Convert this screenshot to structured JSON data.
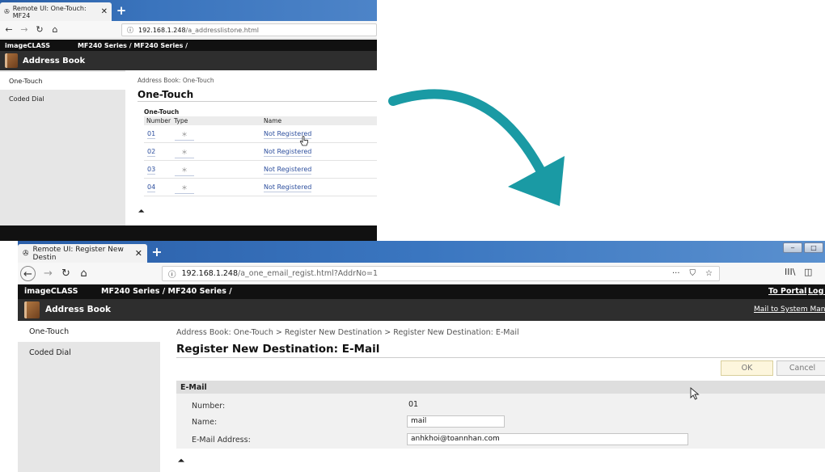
{
  "shot1": {
    "tab_title": "Remote UI: One-Touch: MF24",
    "tab_close": "✕",
    "new_tab": "+",
    "url_host": "192.168.1.248",
    "url_path": "/a_addresslistone.html",
    "brand": "imageCLASS",
    "series": "MF240 Series / MF240 Series /",
    "section_title": "Address Book",
    "sidebar": [
      {
        "label": "One-Touch",
        "active": true
      },
      {
        "label": "Coded Dial",
        "active": false
      }
    ],
    "breadcrumb": "Address Book: One-Touch",
    "page_title": "One-Touch",
    "subheading": "One-Touch",
    "columns": {
      "number": "Number",
      "type": "Type",
      "name": "Name"
    },
    "rows": [
      {
        "number": "01",
        "type": "＊",
        "name": "Not Registered"
      },
      {
        "number": "02",
        "type": "＊",
        "name": "Not Registered"
      },
      {
        "number": "03",
        "type": "＊",
        "name": "Not Registered"
      },
      {
        "number": "04",
        "type": "＊",
        "name": "Not Registered"
      }
    ],
    "to_top": "⏶"
  },
  "shot2": {
    "tab_title": "Remote UI: Register New Destin",
    "tab_close": "✕",
    "new_tab": "+",
    "url_host": "192.168.1.248",
    "url_path": "/a_one_email_regist.html?AddrNo=1",
    "url_actions": {
      "more": "···",
      "pocket": "⛉",
      "bookmark": "☆"
    },
    "toolbar": {
      "library": "III\\",
      "sidebar": "◫"
    },
    "brand": "imageCLASS",
    "series": "MF240 Series / MF240 Series /",
    "to_portal": "To Portal",
    "logout": "Log O",
    "section_title": "Address Book",
    "mail_admin": "Mail to System Manag",
    "sidebar": [
      {
        "label": "One-Touch",
        "active": true
      },
      {
        "label": "Coded Dial",
        "active": false
      }
    ],
    "breadcrumb": "Address Book: One-Touch > Register New Destination > Register New Destination: E-Mail",
    "page_title": "Register New Destination: E-Mail",
    "ok_label": "OK",
    "cancel_label": "Cancel",
    "panel_title": "E-Mail",
    "number_label": "Number:",
    "number_value": "01",
    "name_label": "Name:",
    "name_value": "mail",
    "email_label": "E-Mail Address:",
    "email_value": "anhkhoi@toannhan.com",
    "to_top": "⏶"
  },
  "colors": {
    "arrow": "#1a9aa4",
    "link": "#2d4f9e",
    "header_dark": "#111111",
    "section_bar": "#2e2e2e",
    "ok_button": "#fdf6dd"
  }
}
